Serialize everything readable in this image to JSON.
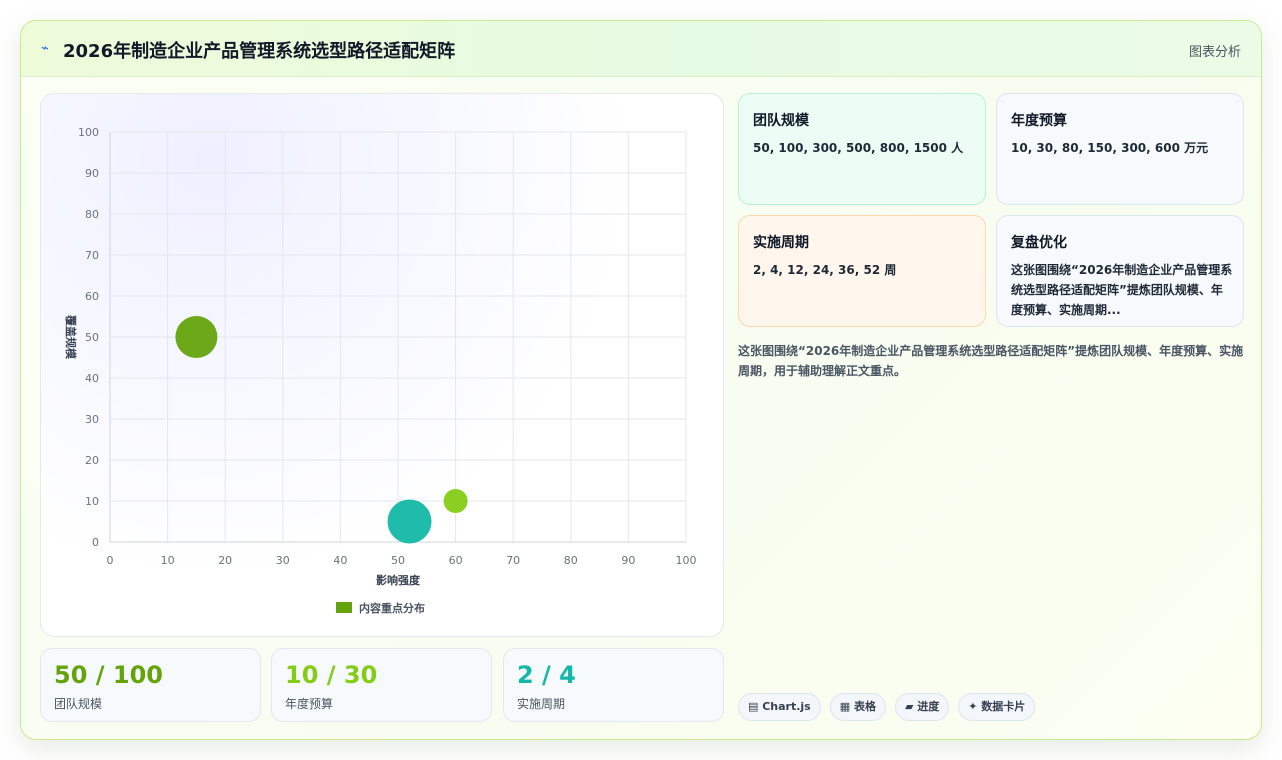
{
  "header": {
    "logo_icon": "⌁",
    "title": "2026年制造企业产品管理系统选型路径适配矩阵",
    "tag": "图表分析"
  },
  "chart_data": {
    "type": "bubble",
    "xlabel": "影响强度",
    "ylabel": "覆盖规模",
    "xlim": [
      0,
      100
    ],
    "ylim": [
      0,
      100
    ],
    "xticks": [
      "0",
      "10",
      "20",
      "30",
      "40",
      "50",
      "60",
      "70",
      "80",
      "90",
      "100"
    ],
    "yticks": [
      "0",
      "10",
      "20",
      "30",
      "40",
      "50",
      "60",
      "70",
      "80",
      "90",
      "100"
    ],
    "grid": true,
    "legend_position": "bottom",
    "series": [
      {
        "name": "内容重点分布",
        "points": [
          {
            "x": 15,
            "y": 50,
            "r": 21,
            "color": "#65a30d"
          },
          {
            "x": 52,
            "y": 5,
            "r": 22,
            "color": "#14b8a6"
          },
          {
            "x": 60,
            "y": 10,
            "r": 12,
            "color": "#84cc16"
          }
        ],
        "legend_color": "#65a30d"
      }
    ]
  },
  "metrics": [
    {
      "value": "50 / 100",
      "label": "团队规模",
      "color": "#65a30d"
    },
    {
      "value": "10 / 30",
      "label": "年度预算",
      "color": "#84cc16"
    },
    {
      "value": "2 / 4",
      "label": "实施周期",
      "color": "#14b8a6"
    }
  ],
  "info_cards": [
    {
      "title": "团队规模",
      "text": "50, 100, 300, 500, 800, 1500 人",
      "bg": "#ecfdf5",
      "border": "#bbf0d5"
    },
    {
      "title": "年度预算",
      "text": "10, 30, 80, 150, 300, 600 万元",
      "bg": "#f7fafc",
      "border": "#dbe6ef"
    },
    {
      "title": "实施周期",
      "text": "2, 4, 12, 24, 36, 52 周",
      "bg": "#fff7ed",
      "border": "#fbd7ad"
    },
    {
      "title": "复盘优化",
      "text": "这张图围绕“2026年制造企业产品管理系统选型路径适配矩阵”提炼团队规模、年度预算、实施周期...",
      "bg": "#f7fafc",
      "border": "#dbe6ef"
    }
  ],
  "summary": "这张图围绕“2026年制造企业产品管理系统选型路径适配矩阵”提炼团队规模、年度预算、实施周期，用于辅助理解正文重点。",
  "pills": [
    "▤ Chart.js",
    "▦ 表格",
    "▰ 进度",
    "✦ 数据卡片"
  ]
}
